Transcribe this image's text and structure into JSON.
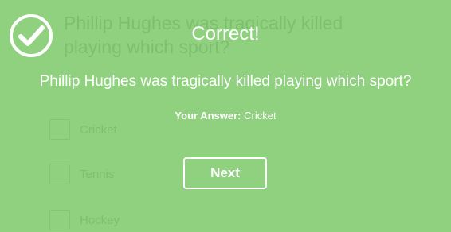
{
  "quiz": {
    "question": "Phillip Hughes was tragically killed playing which sport?",
    "options": [
      {
        "label": "Cricket"
      },
      {
        "label": "Tennis"
      },
      {
        "label": "Hockey"
      }
    ]
  },
  "result": {
    "title": "Correct!",
    "question": "Phillip Hughes was tragically killed playing which sport?",
    "answer_label": "Your Answer:",
    "answer_value": "Cricket",
    "next_label": "Next"
  },
  "colors": {
    "background": "#8fd17f",
    "foreground": "#ffffff"
  },
  "icons": {
    "result": "check-circle-icon"
  }
}
